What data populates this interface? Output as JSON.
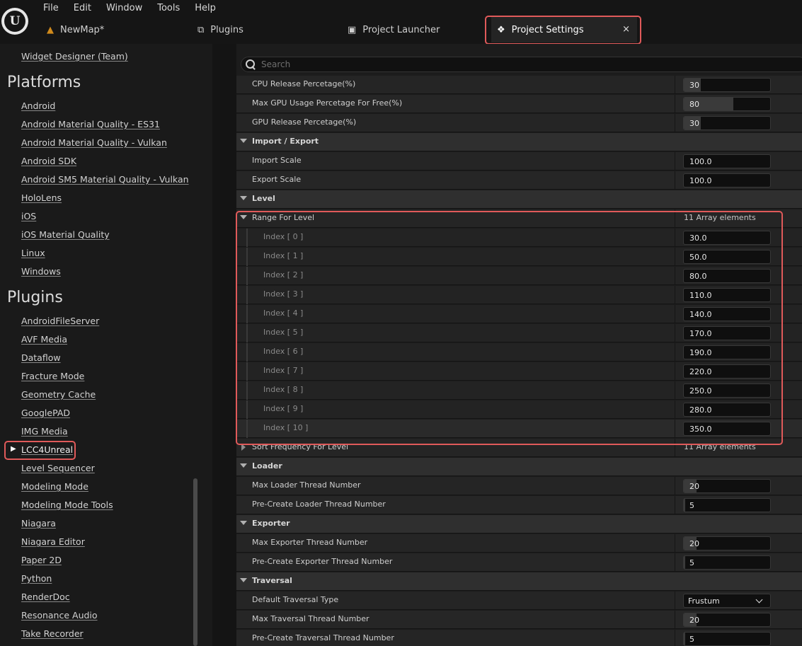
{
  "menu": [
    "File",
    "Edit",
    "Window",
    "Tools",
    "Help"
  ],
  "tabs": {
    "newmap": "NewMap*",
    "plugins": "Plugins",
    "launcher": "Project Launcher",
    "settings": "Project Settings",
    "close_glyph": "×"
  },
  "nav": {
    "top_cut_item": "Widget Designer (Team)",
    "platforms_header": "Platforms",
    "platforms": [
      "Android",
      "Android Material Quality - ES31",
      "Android Material Quality - Vulkan",
      "Android SDK",
      "Android SM5 Material Quality - Vulkan",
      "HoloLens",
      "iOS",
      "iOS Material Quality",
      "Linux",
      "Windows"
    ],
    "plugins_header": "Plugins",
    "plugins": [
      "AndroidFileServer",
      "AVF Media",
      "Dataflow",
      "Fracture Mode",
      "Geometry Cache",
      "GooglePAD",
      "IMG Media",
      "LCC4Unreal",
      "Level Sequencer",
      "Modeling Mode",
      "Modeling Mode Tools",
      "Niagara",
      "Niagara Editor",
      "Paper 2D",
      "Python",
      "RenderDoc",
      "Resonance Audio",
      "Take Recorder"
    ]
  },
  "search": {
    "placeholder": "Search"
  },
  "settings": {
    "cpu_release": {
      "label": "CPU Release Percetage(%)",
      "value": "30",
      "fill_pct": 20
    },
    "max_gpu": {
      "label": "Max GPU Usage Percetage For Free(%)",
      "value": "80",
      "fill_pct": 57
    },
    "gpu_release": {
      "label": "GPU Release Percetage(%)",
      "value": "30",
      "fill_pct": 20
    },
    "import_export": {
      "header": "Import / Export",
      "import_label": "Import Scale",
      "import_value": "100.0",
      "export_label": "Export Scale",
      "export_value": "100.0"
    },
    "level": {
      "header": "Level",
      "range_label": "Range For Level",
      "range_count": "11 Array elements",
      "indices": [
        "Index [ 0 ]",
        "Index [ 1 ]",
        "Index [ 2 ]",
        "Index [ 3 ]",
        "Index [ 4 ]",
        "Index [ 5 ]",
        "Index [ 6 ]",
        "Index [ 7 ]",
        "Index [ 8 ]",
        "Index [ 9 ]",
        "Index [ 10 ]"
      ],
      "values": [
        "30.0",
        "50.0",
        "80.0",
        "110.0",
        "140.0",
        "170.0",
        "190.0",
        "220.0",
        "250.0",
        "280.0",
        "350.0"
      ],
      "sort_label": "Sort Frequency For Level",
      "sort_count": "11 Array elements"
    },
    "loader": {
      "header": "Loader",
      "max_label": "Max Loader Thread Number",
      "max_value": "20",
      "max_fill_pct": 15,
      "pre_label": "Pre-Create Loader Thread Number",
      "pre_value": "5",
      "pre_fill_pct": 2
    },
    "exporter": {
      "header": "Exporter",
      "max_label": "Max Exporter Thread Number",
      "max_value": "20",
      "max_fill_pct": 15,
      "pre_label": "Pre-Create Exporter Thread Number",
      "pre_value": "5",
      "pre_fill_pct": 2
    },
    "traversal": {
      "header": "Traversal",
      "type_label": "Default Traversal Type",
      "type_value": "Frustum",
      "max_label": "Max Traversal Thread Number",
      "max_value": "20",
      "max_fill_pct": 15,
      "pre_label": "Pre-Create Traversal Thread Number",
      "pre_value": "5",
      "pre_fill_pct": 2
    }
  },
  "colors": {
    "highlight": "#e05a5a",
    "accent_orange": "#d08a1c"
  }
}
